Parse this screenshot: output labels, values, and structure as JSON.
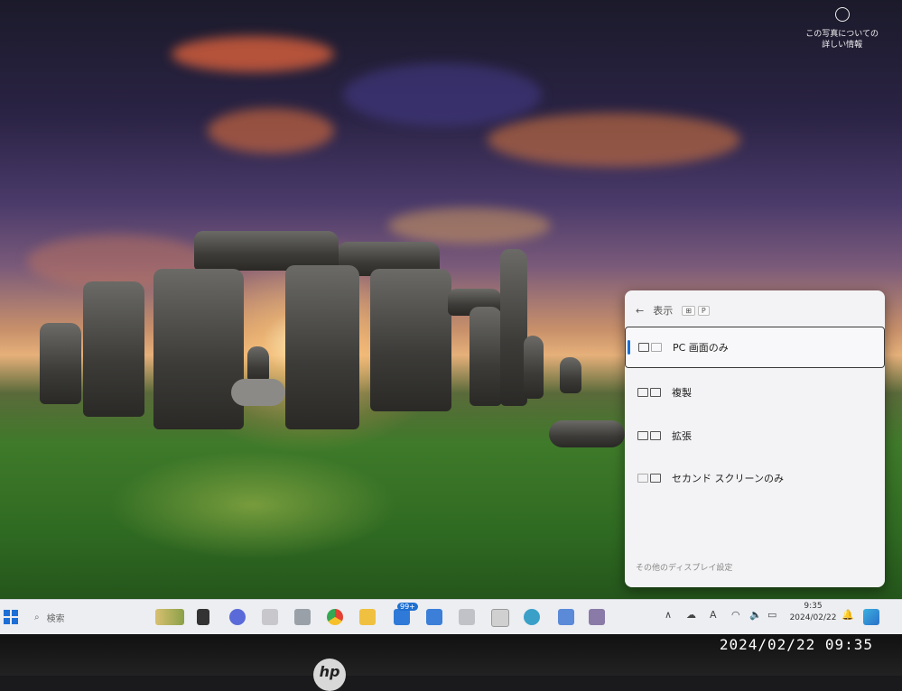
{
  "desktop": {
    "photo_info_line1": "この写真についての",
    "photo_info_line2": "詳しい情報"
  },
  "project_panel": {
    "back_icon": "←",
    "title": "表示",
    "shortcut_win": "⊞",
    "shortcut_key": "P",
    "options": [
      {
        "label": "PC 画面のみ",
        "selected": true
      },
      {
        "label": "複製",
        "selected": false
      },
      {
        "label": "拡張",
        "selected": false
      },
      {
        "label": "セカンド スクリーンのみ",
        "selected": false
      }
    ],
    "footer_link": "その他のディスプレイ設定"
  },
  "taskbar": {
    "search_placeholder": "検索",
    "mail_badge": "99+",
    "tray_ime": "A",
    "clock_time": "9:35",
    "clock_date": "2024/02/22"
  },
  "photo_stamp": {
    "timestamp": "2024/02/22  09:35",
    "brand": "hp"
  },
  "colors": {
    "accent": "#1e6fd0",
    "panel_bg": "#f3f3f5",
    "taskbar_bg": "#eceef2"
  }
}
